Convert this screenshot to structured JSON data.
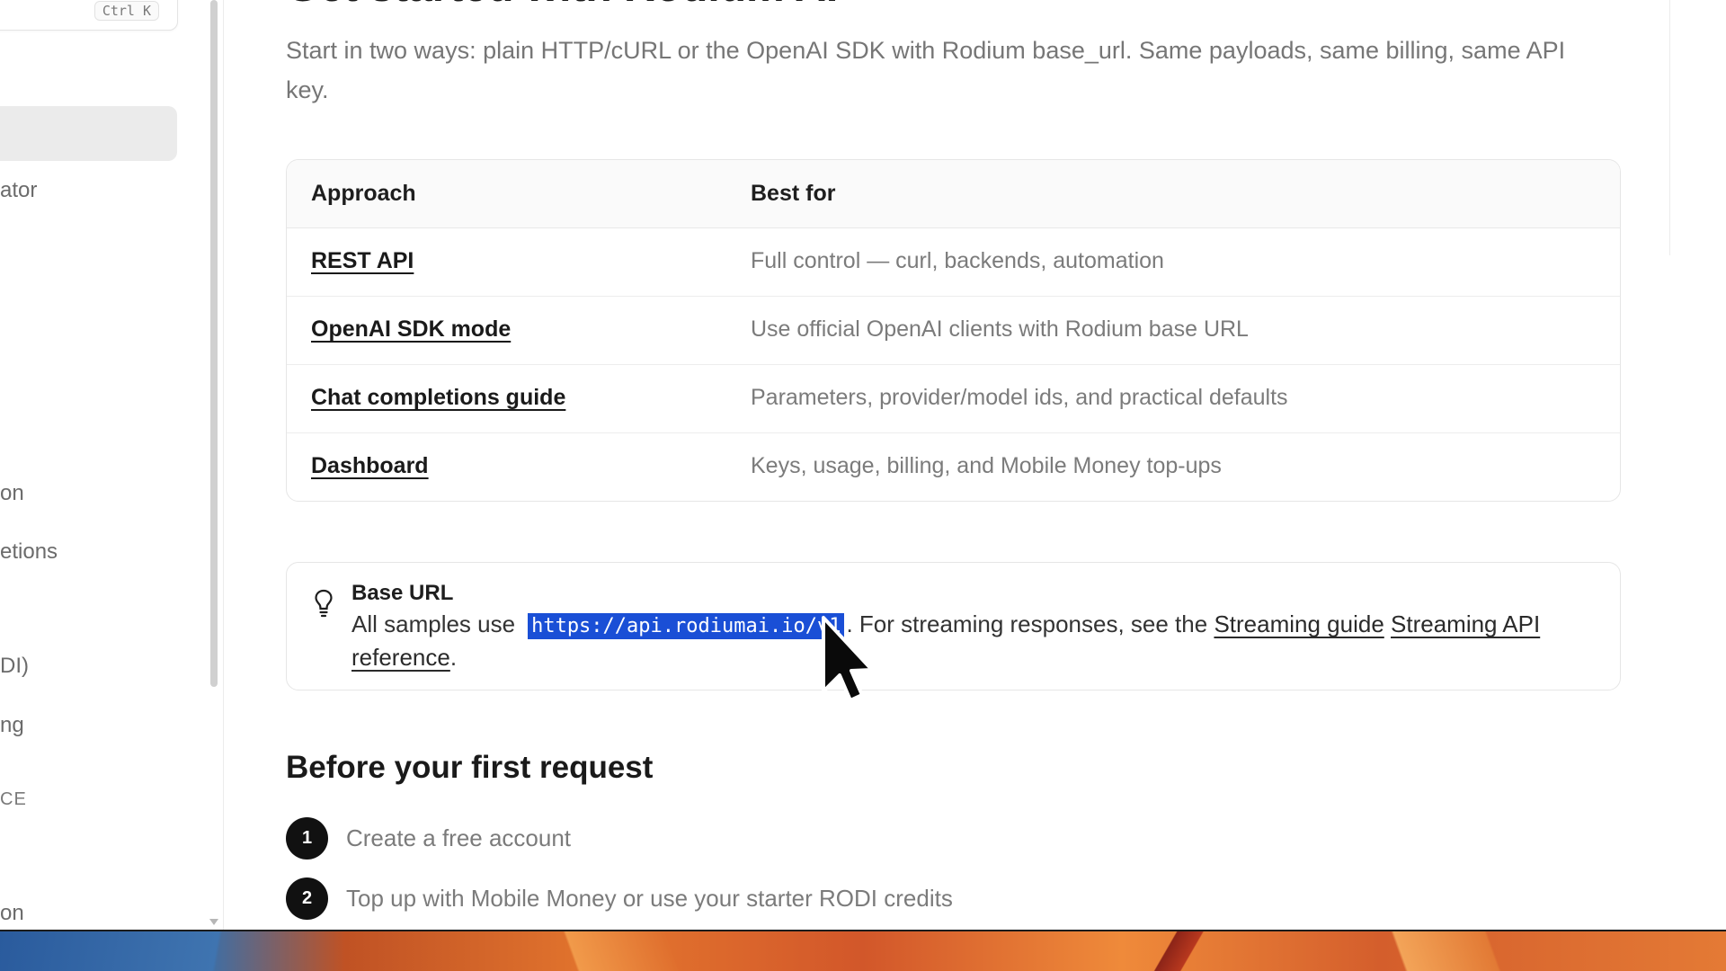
{
  "sidebar": {
    "search_shortcut": "Ctrl K",
    "items": [
      {
        "label": "ator"
      },
      {
        "label": "on"
      },
      {
        "label": "etions"
      },
      {
        "label": "DI)"
      },
      {
        "label": "ng"
      },
      {
        "label": "CE"
      },
      {
        "label": "on"
      }
    ]
  },
  "main": {
    "title": "Get started with Rodium AI",
    "intro": "Start in two ways: plain HTTP/cURL or the OpenAI SDK with Rodium base_url. Same payloads, same billing, same API key.",
    "table": {
      "headers": [
        "Approach",
        "Best for"
      ],
      "rows": [
        {
          "approach": "REST API",
          "best_for": "Full control — curl, backends, automation"
        },
        {
          "approach": "OpenAI SDK mode",
          "best_for": "Use official OpenAI clients with Rodium base URL"
        },
        {
          "approach": "Chat completions guide",
          "best_for": "Parameters, provider/model ids, and practical defaults"
        },
        {
          "approach": "Dashboard",
          "best_for": "Keys, usage, billing, and Mobile Money top-ups"
        }
      ]
    },
    "callout": {
      "icon": "lightbulb-icon",
      "title": "Base URL",
      "text_before": "All samples use",
      "code": "https://api.rodiumai.io/v1",
      "text_after": ". For streaming responses, see the",
      "link1": "Streaming guide",
      "link2": "Streaming API reference",
      "end": "."
    },
    "section_title": "Before your first request",
    "steps": [
      {
        "num": "1",
        "text": "Create a free account"
      },
      {
        "num": "2",
        "text": "Top up with Mobile Money or use your starter RODI credits"
      }
    ]
  },
  "colors": {
    "selection": "#1a4fd6",
    "step_badge": "#111111",
    "muted_text": "#7b7b7b"
  }
}
